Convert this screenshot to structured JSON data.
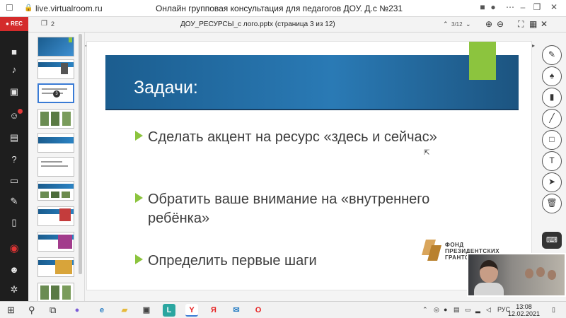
{
  "window": {
    "url": "live.virtualroom.ru",
    "title": "Онлайн групповая консультация для педагогов ДОУ. Д.с №231"
  },
  "sidebar": {
    "rec_label": "● REC",
    "icons": [
      "camera-icon",
      "microphone-icon",
      "screen-share-icon",
      "participants-icon",
      "chat-icon",
      "questions-icon",
      "presentation-icon",
      "pen-icon",
      "document-icon",
      "record-icon",
      "add-user-icon",
      "settings-icon"
    ]
  },
  "toolbar": {
    "pages_count": "2",
    "document_title": "ДОУ_РЕСУРСЫ_с лого.pptx (страница 3 из 12)",
    "page_indicator": "3/12"
  },
  "slide": {
    "heading": "Задачи:",
    "bullets": [
      "Сделать акцент на ресурс «здесь и сейчас»",
      "Обратить ваше внимание на «внутреннего ребёнка»",
      "Определить первые шаги"
    ],
    "logo_text": "ФОНД ПРЕЗИДЕНТСКИХ ГРАНТОВ"
  },
  "thumbnails": {
    "current_badge": "3"
  },
  "tools": [
    "pencil-icon",
    "brush-icon",
    "marker-icon",
    "line-icon",
    "rectangle-icon",
    "text-icon",
    "pointer-icon",
    "trash-icon"
  ],
  "taskbar": {
    "language": "РУС",
    "time": "13:08",
    "date": "12.02.2021"
  },
  "colors": {
    "accent_green": "#8cc43e",
    "header_blue": "#2a7ab5",
    "rec_red": "#d42b2b"
  }
}
